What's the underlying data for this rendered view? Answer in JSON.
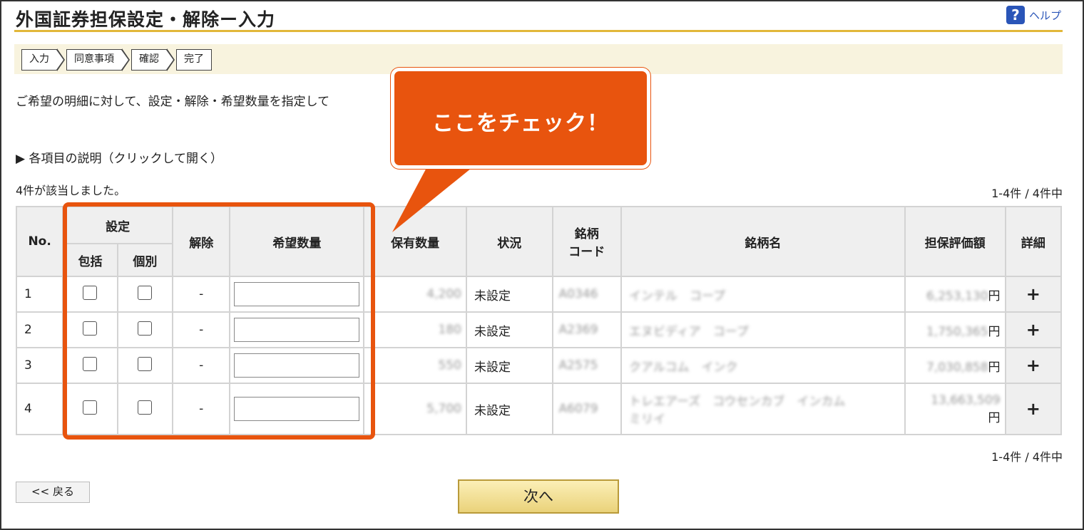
{
  "header": {
    "title": "外国証券担保設定・解除ー入力",
    "help_label": "ヘルプ",
    "help_icon_glyph": "?"
  },
  "steps": [
    "入力",
    "同意事項",
    "確認",
    "完了"
  ],
  "intro_text": "ご希望の明細に対して、設定・解除・希望数量を指定して",
  "explain_link": "▶ 各項目の説明（クリックして開く）",
  "result_count": "4件が該当しました。",
  "pagination": {
    "top": "1-4件 / 4件中",
    "bottom": "1-4件 / 4件中"
  },
  "table": {
    "headers": {
      "no": "No.",
      "setting": "設定",
      "bulk": "包括",
      "individual": "個別",
      "release": "解除",
      "desired_qty": "希望数量",
      "holding_qty": "保有数量",
      "status": "状況",
      "code_line1": "銘柄",
      "code_line2": "コード",
      "name": "銘柄名",
      "value": "担保評価額",
      "detail": "詳細"
    },
    "rows": [
      {
        "no": "1",
        "release": "-",
        "holding": "4,200",
        "status": "未設定",
        "code": "A0346",
        "name": "インテル　コープ",
        "value": "6,253,130",
        "yen": "円",
        "detail": "+"
      },
      {
        "no": "2",
        "release": "-",
        "holding": "180",
        "status": "未設定",
        "code": "A2369",
        "name": "エヌビディア　コープ",
        "value": "1,750,365",
        "yen": "円",
        "detail": "+"
      },
      {
        "no": "3",
        "release": "-",
        "holding": "550",
        "status": "未設定",
        "code": "A2575",
        "name": "クアルコム　インク",
        "value": "7,030,858",
        "yen": "円",
        "detail": "+"
      },
      {
        "no": "4",
        "release": "-",
        "holding": "5,700",
        "status": "未設定",
        "code": "A6079",
        "name": "トレエアーズ　コウセンカブ　インカム",
        "name2": "ミリイ",
        "value": "13,663,509",
        "yen": "円",
        "detail": "+"
      }
    ]
  },
  "callout": "ここをチェック！",
  "buttons": {
    "back": "<< 戻る",
    "next": "次へ"
  },
  "colors": {
    "accent": "#e8540e",
    "title_underline": "#e2b73a",
    "help_blue": "#2a55b8"
  }
}
